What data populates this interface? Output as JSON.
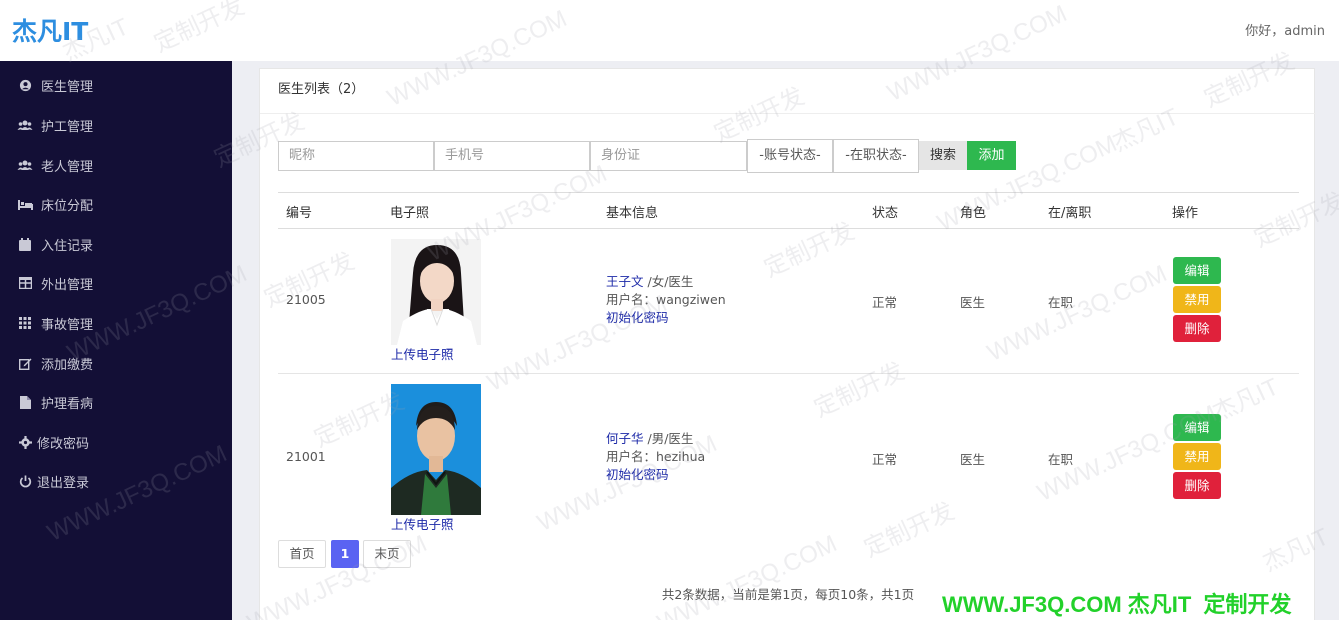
{
  "header": {
    "logo": "杰凡IT",
    "greeting": "你好，admin"
  },
  "sidebar": {
    "items": [
      {
        "label": "医生管理",
        "icon": "user-circle-icon"
      },
      {
        "label": "护工管理",
        "icon": "users-icon"
      },
      {
        "label": "老人管理",
        "icon": "users-icon"
      },
      {
        "label": "床位分配",
        "icon": "bed-icon"
      },
      {
        "label": "入住记录",
        "icon": "calendar-icon"
      },
      {
        "label": "外出管理",
        "icon": "table-icon"
      },
      {
        "label": "事故管理",
        "icon": "grid-icon"
      },
      {
        "label": "添加缴费",
        "icon": "edit-icon"
      },
      {
        "label": "护理看病",
        "icon": "file-icon"
      },
      {
        "label": "修改密码",
        "icon": "gear-icon"
      },
      {
        "label": "退出登录",
        "icon": "power-icon"
      }
    ]
  },
  "main": {
    "title": "医生列表（2）",
    "filters": {
      "nickname_placeholder": "昵称",
      "phone_placeholder": "手机号",
      "idcard_placeholder": "身份证",
      "account_status": "-账号状态-",
      "job_status": "-在职状态-",
      "search_label": "搜索",
      "add_label": "添加"
    },
    "table": {
      "headers": [
        "编号",
        "电子照",
        "基本信息",
        "状态",
        "角色",
        "在/离职",
        "操作"
      ],
      "rows": [
        {
          "id": "21005",
          "upload_label": "上传电子照",
          "name": "王子文",
          "gender_role": " /女/医生",
          "username": "用户名：wangziwen",
          "reset_label": "初始化密码",
          "status": "正常",
          "role": "医生",
          "employment": "在职",
          "photo": "female-portrait-white-background"
        },
        {
          "id": "21001",
          "upload_label": "上传电子照",
          "name": "何子华",
          "gender_role": " /男/医生",
          "username": "用户名：hezihua",
          "reset_label": "初始化密码",
          "status": "正常",
          "role": "医生",
          "employment": "在职",
          "photo": "male-portrait-blue-background"
        }
      ],
      "actions": {
        "edit": "编辑",
        "ban": "禁用",
        "delete": "删除"
      }
    },
    "pagination": {
      "first": "首页",
      "current": "1",
      "last": "末页",
      "summary": "共2条数据，当前是第1页，每页10条，共1页"
    }
  },
  "watermark": {
    "text_site": "WWW.JF3Q.COM",
    "text_brand": "杰凡IT",
    "text_custom": "定制开发",
    "banner": "WWW.JF3Q.COM 杰凡IT  定制开发",
    "banner_color": "#22d12a"
  },
  "colors": {
    "sidebar_bg": "#130f36",
    "primary_green": "#2eb84f",
    "warning_yellow": "#f0b619",
    "danger_red": "#e0213b",
    "pager_active": "#5a63f2",
    "link_blue": "#1d2aa8"
  }
}
